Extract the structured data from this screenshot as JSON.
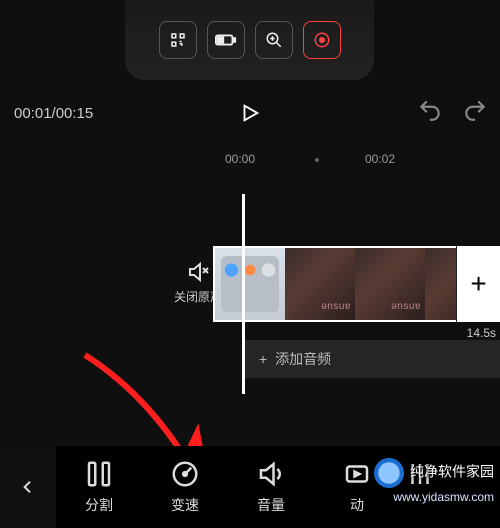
{
  "preview_controls": {
    "qr_icon": "qr-icon",
    "battery_icon": "battery-icon",
    "zoom_icon": "zoom-in-icon",
    "record_icon": "record-icon"
  },
  "playback": {
    "current": "00:01",
    "total": "00:15",
    "combined": "00:01/00:15"
  },
  "ruler": {
    "tick1": "00:00",
    "tick2": "00:02"
  },
  "mute": {
    "label": "关闭原声"
  },
  "clip": {
    "duration_label": "14.5s"
  },
  "audio": {
    "add_label": "添加音频"
  },
  "toolbar": {
    "split": "分割",
    "speed": "变速",
    "volume": "音量",
    "animation": "动"
  },
  "watermark": {
    "title": "纯净软件家园",
    "url": "www.yidasmw.com"
  },
  "add_clip": {
    "glyph": "+"
  },
  "audio_plus": {
    "glyph": "+"
  }
}
